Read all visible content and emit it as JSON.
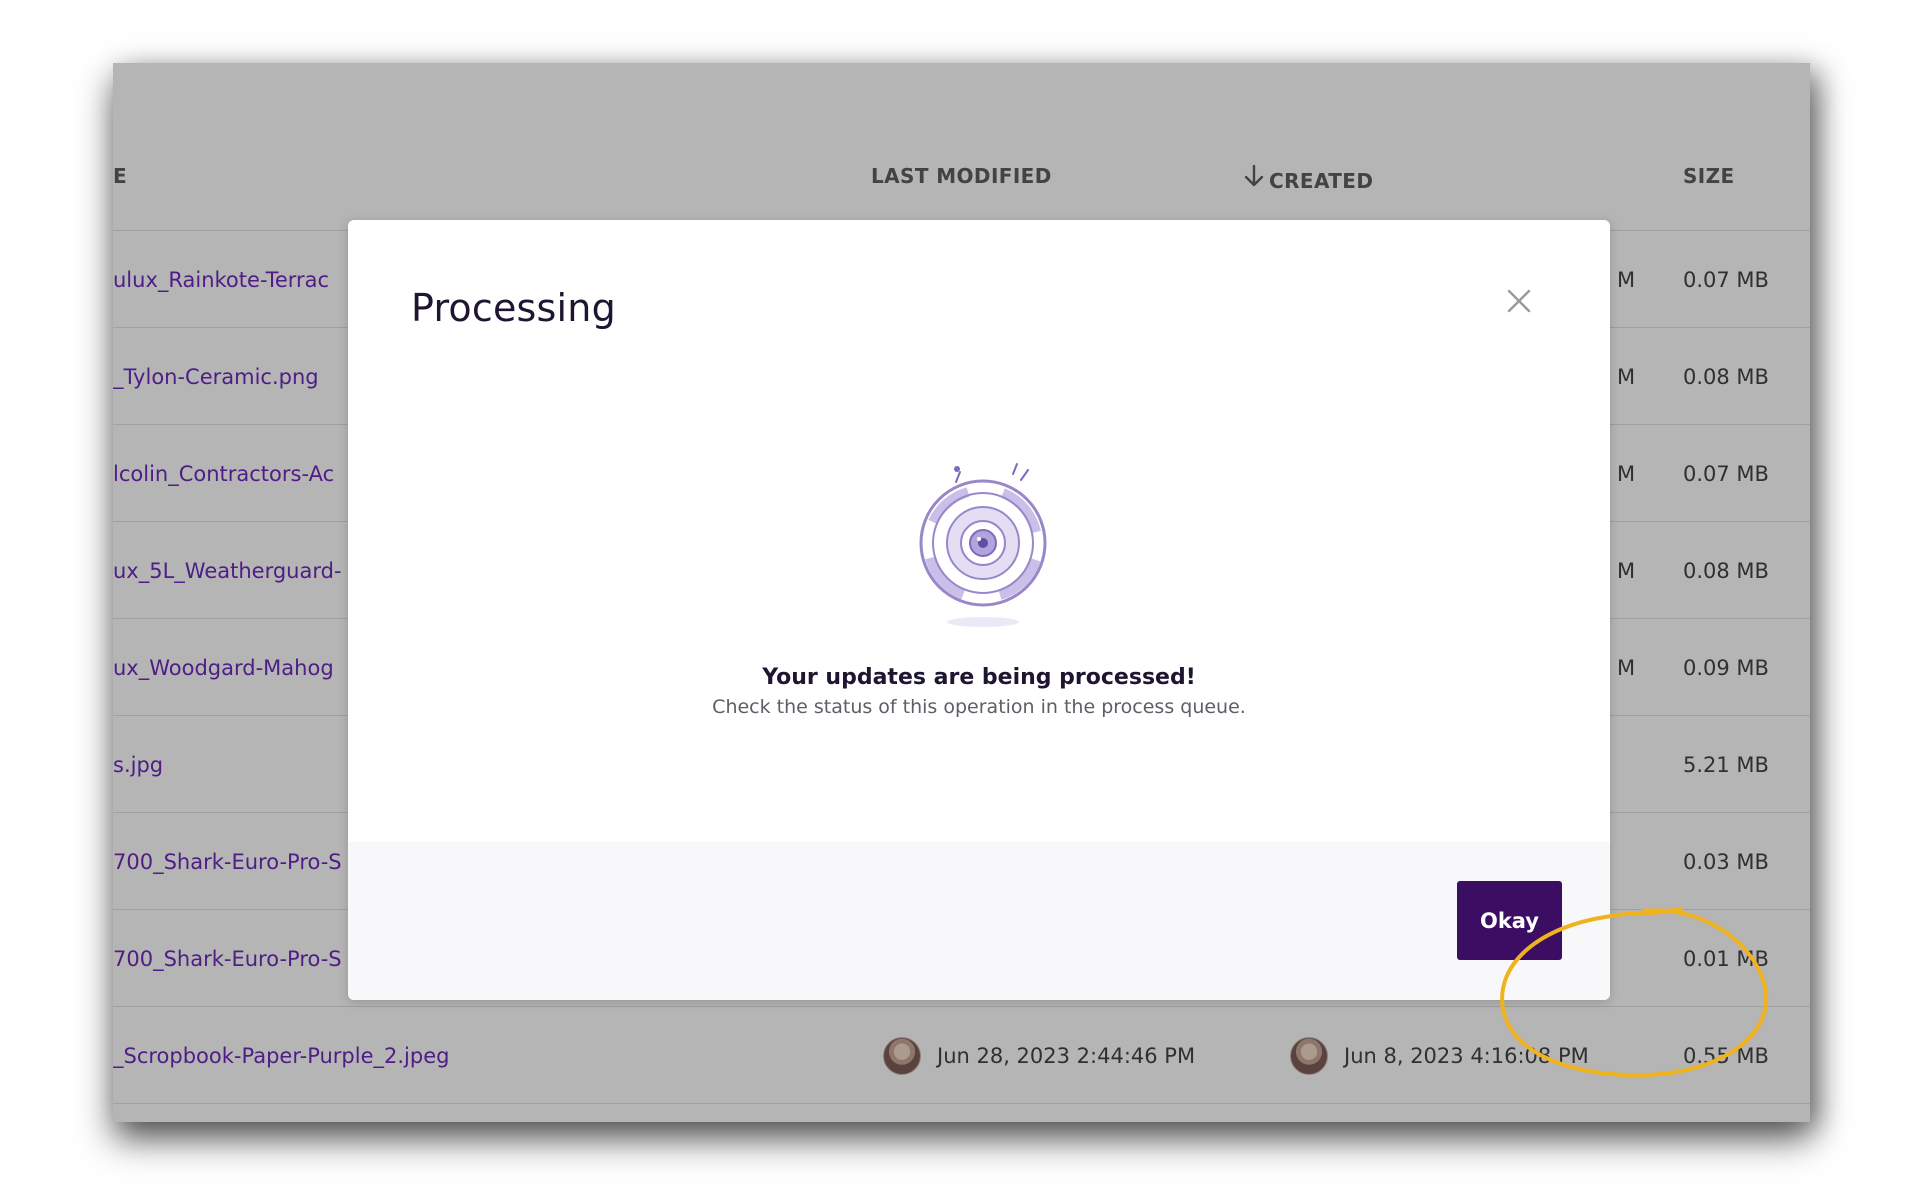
{
  "table": {
    "headers": {
      "name": "E",
      "last_modified": "LAST MODIFIED",
      "created": "CREATED",
      "size": "SIZE"
    },
    "rows": [
      {
        "name": "ulux_Rainkote-Terrac",
        "modified_tail": "M",
        "size": "0.07 MB"
      },
      {
        "name": "_Tylon-Ceramic.png",
        "modified_tail": "M",
        "size": "0.08 MB"
      },
      {
        "name": "lcolin_Contractors-Ac",
        "modified_tail": "M",
        "size": "0.07 MB"
      },
      {
        "name": "ux_5L_Weatherguard-",
        "modified_tail": "M",
        "size": "0.08 MB"
      },
      {
        "name": "ux_Woodgard-Mahog",
        "modified_tail": "M",
        "size": "0.09 MB"
      },
      {
        "name": "s.jpg",
        "modified_tail": "",
        "size": "5.21 MB"
      },
      {
        "name": "700_Shark-Euro-Pro-S",
        "modified_tail": "",
        "size": "0.03 MB"
      },
      {
        "name": "700_Shark-Euro-Pro-S",
        "modified_tail": "",
        "size": "0.01 MB"
      },
      {
        "name": "_Scropbook-Paper-Purple_2.jpeg",
        "last_modified": "Jun 28, 2023 2:44:46 PM",
        "created": "Jun 8, 2023 4:16:08 PM",
        "size": "0.55 MB"
      }
    ]
  },
  "modal": {
    "title": "Processing",
    "message_title": "Your updates are being processed!",
    "message_subtitle": "Check the status of this operation in the process queue.",
    "okay_label": "Okay",
    "close_icon": "close-icon",
    "illustration_icon": "processing-gear-icon"
  },
  "colors": {
    "brand_purple": "#3b0d63",
    "link_purple": "#6f2bbd",
    "highlight_yellow": "#f0b21d"
  }
}
